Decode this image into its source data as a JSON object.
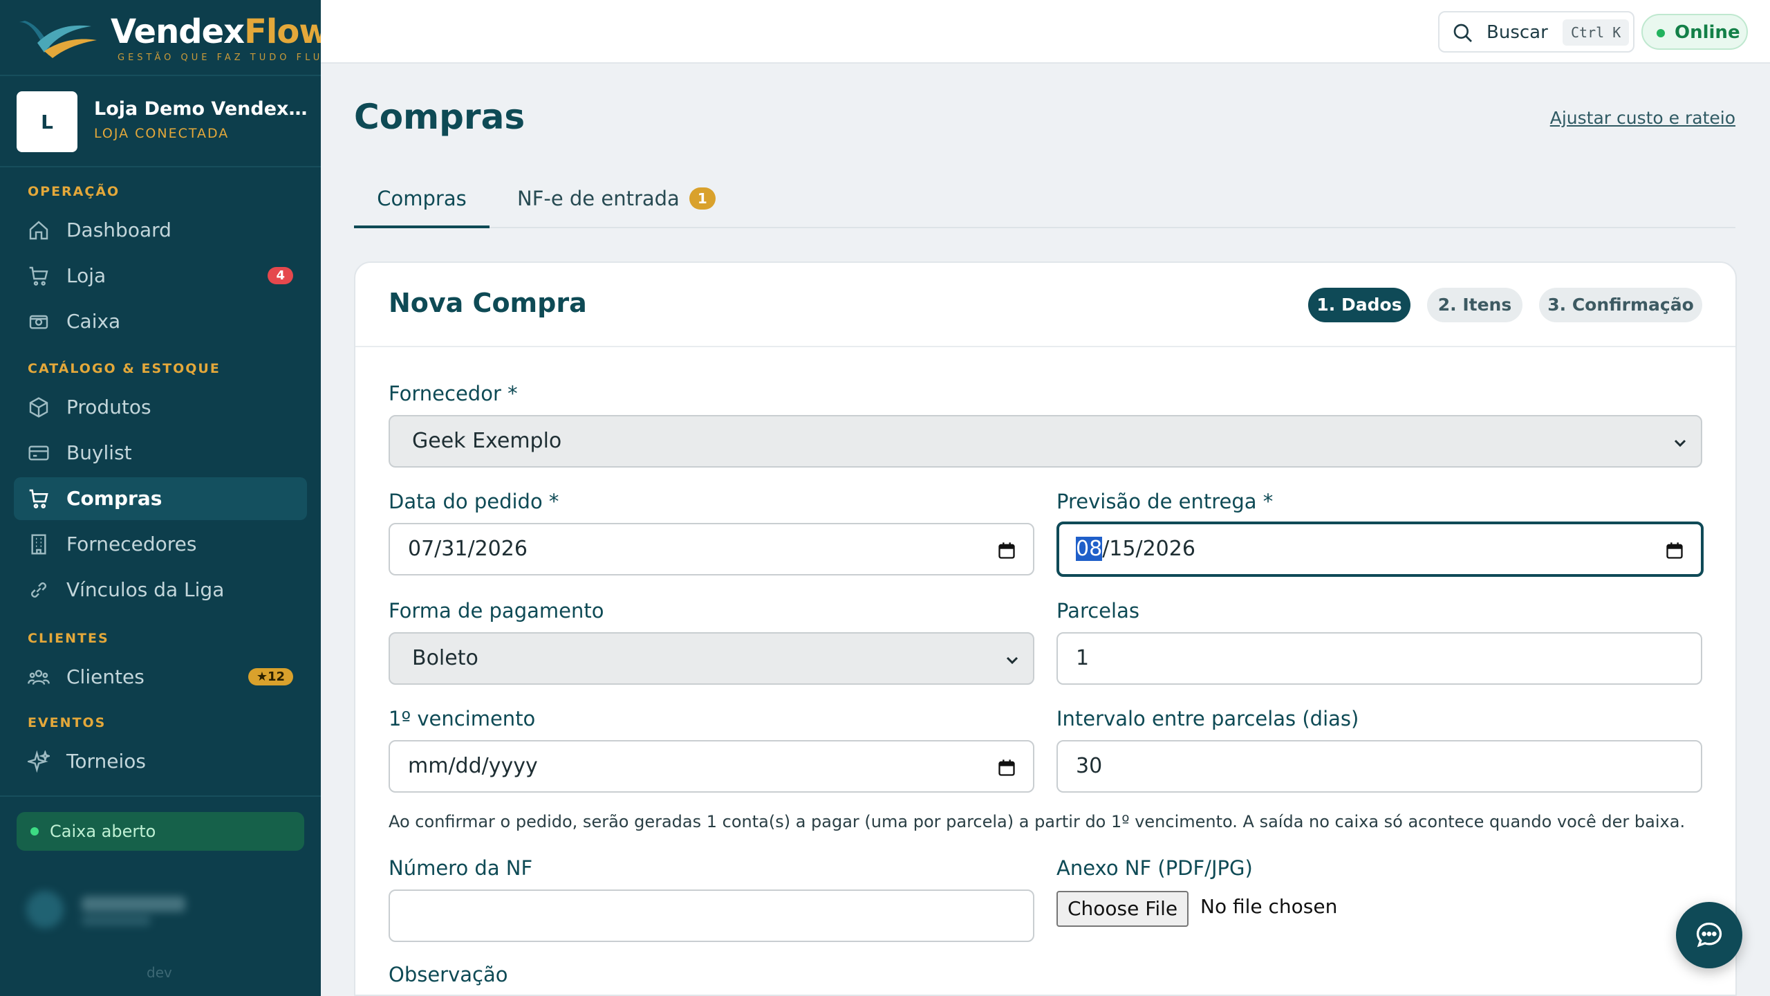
{
  "brand": {
    "name_main": "Vendex",
    "name_accent": "Flow",
    "tagline": "GESTÃO QUE FAZ TUDO FLUIR"
  },
  "store": {
    "initial": "L",
    "name": "Loja Demo VendexFlow",
    "status": "LOJA CONECTADA"
  },
  "sidebar": {
    "sections": {
      "operacao": "OPERAÇÃO",
      "catalogo": "CATÁLOGO & ESTOQUE",
      "clientes": "CLIENTES",
      "eventos": "EVENTOS"
    },
    "items": {
      "dashboard": {
        "label": "Dashboard"
      },
      "loja": {
        "label": "Loja",
        "badge": "4"
      },
      "caixa": {
        "label": "Caixa"
      },
      "produtos": {
        "label": "Produtos"
      },
      "buylist": {
        "label": "Buylist"
      },
      "compras": {
        "label": "Compras"
      },
      "fornecedores": {
        "label": "Fornecedores"
      },
      "vinculos": {
        "label": "Vínculos da Liga"
      },
      "clientes": {
        "label": "Clientes",
        "badge": "★12"
      },
      "torneios": {
        "label": "Torneios"
      }
    },
    "cash_status": "Caixa aberto",
    "env": "dev"
  },
  "topbar": {
    "search_label": "Buscar",
    "search_shortcut": "Ctrl K",
    "status": "Online"
  },
  "page": {
    "title": "Compras",
    "link": "Ajustar custo e rateio",
    "tabs": [
      {
        "label": "Compras"
      },
      {
        "label": "NF-e de entrada",
        "badge": "1"
      }
    ]
  },
  "form": {
    "title": "Nova Compra",
    "steps": [
      "1. Dados",
      "2. Itens",
      "3. Confirmação"
    ],
    "fornecedor": {
      "label": "Fornecedor *",
      "value": "Geek Exemplo"
    },
    "data_pedido": {
      "label": "Data do pedido *",
      "value": "07/31/2026"
    },
    "previsao": {
      "label": "Previsão de entrega *",
      "month": "08",
      "rest": "/15/2026"
    },
    "pagamento": {
      "label": "Forma de pagamento",
      "value": "Boleto"
    },
    "parcelas": {
      "label": "Parcelas",
      "value": "1"
    },
    "vencimento": {
      "label": "1º vencimento",
      "placeholder": "mm/dd/yyyy"
    },
    "intervalo": {
      "label": "Intervalo entre parcelas (dias)",
      "value": "30"
    },
    "help_text": "Ao confirmar o pedido, serão geradas 1 conta(s) a pagar (uma por parcela) a partir do 1º vencimento. A saída no caixa só acontece quando você der baixa.",
    "numero_nf": {
      "label": "Número da NF",
      "value": ""
    },
    "anexo": {
      "label": "Anexo NF (PDF/JPG)",
      "button": "Choose File",
      "status": "No file chosen"
    },
    "observacao": {
      "label": "Observação"
    }
  },
  "colors": {
    "sidebar_bg": "#0d3e4c",
    "accent_gold": "#e4a83a",
    "primary": "#0f4a57",
    "online_green": "#22b35e",
    "badge_red": "#e5484d"
  }
}
